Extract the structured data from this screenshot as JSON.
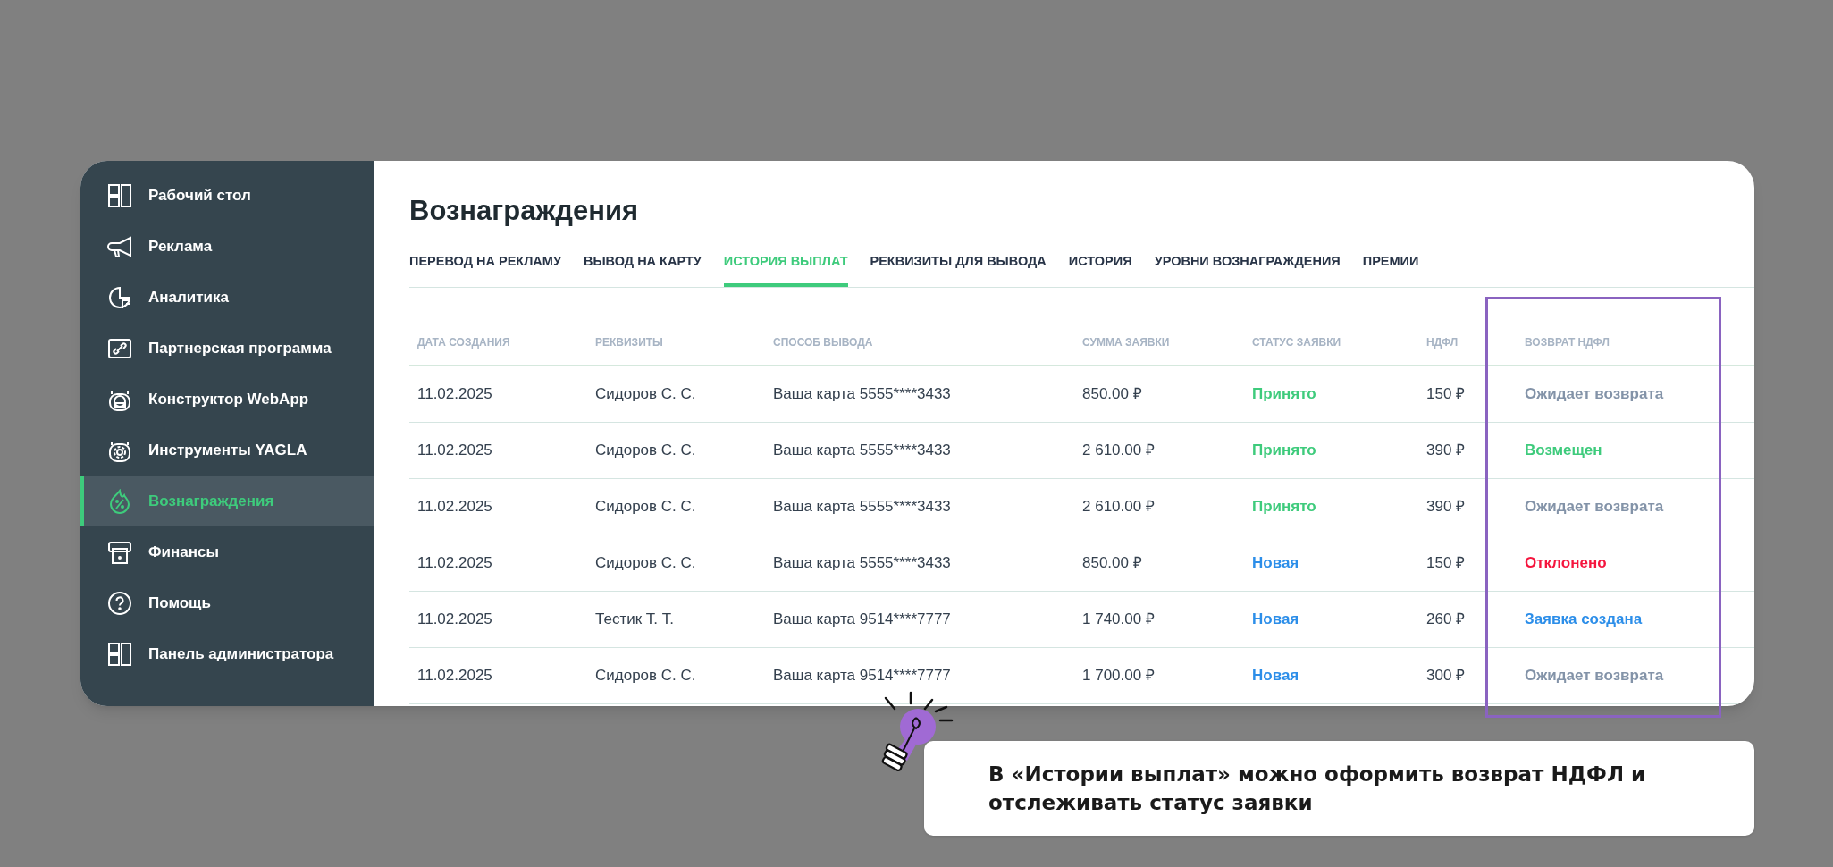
{
  "sidebar": {
    "items": [
      {
        "label": "Рабочий стол",
        "selected": false
      },
      {
        "label": "Реклама",
        "selected": false
      },
      {
        "label": "Аналитика",
        "selected": false
      },
      {
        "label": "Партнерская программа",
        "selected": false
      },
      {
        "label": "Конструктор WebApp",
        "selected": false
      },
      {
        "label": "Инструменты YAGLA",
        "selected": false
      },
      {
        "label": "Вознаграждения",
        "selected": true
      },
      {
        "label": "Финансы",
        "selected": false
      },
      {
        "label": "Помощь",
        "selected": false
      },
      {
        "label": "Панель администратора",
        "selected": false
      }
    ]
  },
  "page": {
    "title": "Вознаграждения"
  },
  "tabs": [
    {
      "label": "ПЕРЕВОД НА РЕКЛАМУ",
      "selected": false
    },
    {
      "label": "ВЫВОД НА КАРТУ",
      "selected": false
    },
    {
      "label": "ИСТОРИЯ ВЫПЛАТ",
      "selected": true
    },
    {
      "label": "РЕКВИЗИТЫ ДЛЯ ВЫВОДА",
      "selected": false
    },
    {
      "label": "ИСТОРИЯ",
      "selected": false
    },
    {
      "label": "УРОВНИ ВОЗНАГРАЖДЕНИЯ",
      "selected": false
    },
    {
      "label": "ПРЕМИИ",
      "selected": false
    }
  ],
  "table": {
    "columns": [
      "ДАТА СОЗДАНИЯ",
      "РЕКВИЗИТЫ",
      "СПОСОБ ВЫВОДА",
      "СУММА ЗАЯВКИ",
      "СТАТУС ЗАЯВКИ",
      "НДФЛ",
      "ВОЗВРАТ НДФЛ"
    ],
    "rows": [
      {
        "date": "11.02.2025",
        "details": "Сидоров С. С.",
        "method": "Ваша карта 5555****3433",
        "amount": "850.00 ₽",
        "status": {
          "text": "Принято",
          "kind": "accepted"
        },
        "tax": "150 ₽",
        "refund": {
          "text": "Ожидает возврата",
          "kind": "pending"
        }
      },
      {
        "date": "11.02.2025",
        "details": "Сидоров С. С.",
        "method": "Ваша карта 5555****3433",
        "amount": "2 610.00 ₽",
        "status": {
          "text": "Принято",
          "kind": "accepted"
        },
        "tax": "390 ₽",
        "refund": {
          "text": "Возмещен",
          "kind": "refunded"
        }
      },
      {
        "date": "11.02.2025",
        "details": "Сидоров С. С.",
        "method": "Ваша карта 5555****3433",
        "amount": "2 610.00 ₽",
        "status": {
          "text": "Принято",
          "kind": "accepted"
        },
        "tax": "390 ₽",
        "refund": {
          "text": "Ожидает возврата",
          "kind": "pending"
        }
      },
      {
        "date": "11.02.2025",
        "details": "Сидоров С. С.",
        "method": "Ваша карта 5555****3433",
        "amount": "850.00 ₽",
        "status": {
          "text": "Новая",
          "kind": "new"
        },
        "tax": "150 ₽",
        "refund": {
          "text": "Отклонено",
          "kind": "rejected"
        }
      },
      {
        "date": "11.02.2025",
        "details": "Тестик Т. Т.",
        "method": "Ваша карта 9514****7777",
        "amount": "1 740.00 ₽",
        "status": {
          "text": "Новая",
          "kind": "new"
        },
        "tax": "260 ₽",
        "refund": {
          "text": "Заявка создана",
          "kind": "created"
        }
      },
      {
        "date": "11.02.2025",
        "details": "Сидоров С. С.",
        "method": "Ваша карта 9514****7777",
        "amount": "1 700.00 ₽",
        "status": {
          "text": "Новая",
          "kind": "new"
        },
        "tax": "300 ₽",
        "refund": {
          "text": "Ожидает возврата",
          "kind": "pending"
        }
      }
    ]
  },
  "callout": {
    "text": "В «Истории выплат» можно оформить возврат НДФЛ и отслеживать статус заявки"
  }
}
